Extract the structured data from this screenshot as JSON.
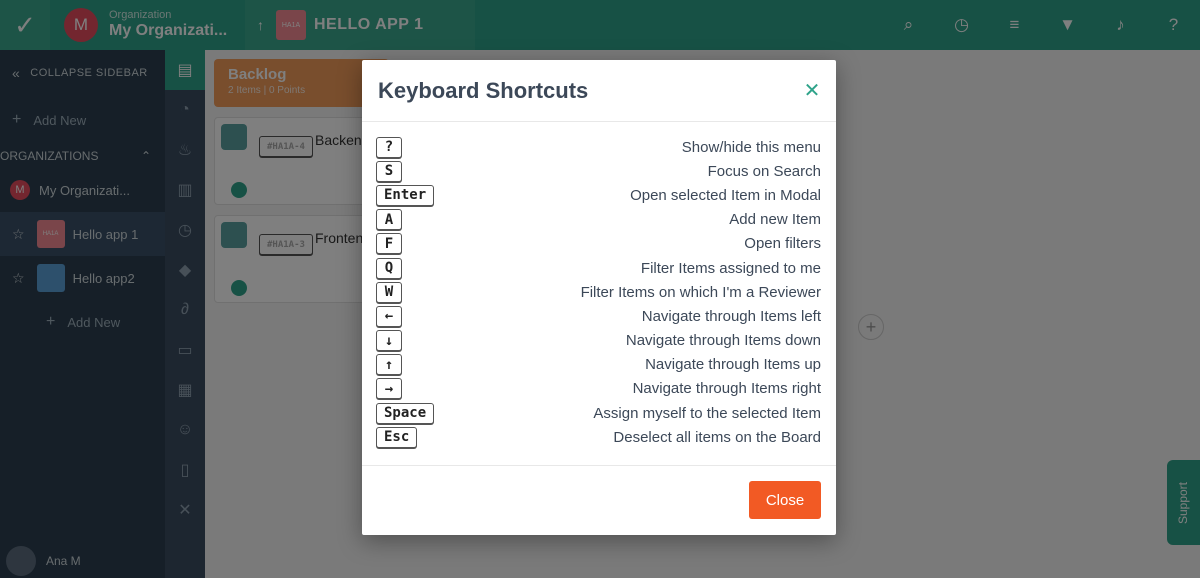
{
  "topbar": {
    "org_label": "Organization",
    "org_name": "My Organizati...",
    "org_initial": "M",
    "app_thumb": "HA1A",
    "app_title": "HELLO APP 1"
  },
  "sidebar": {
    "collapse_label": "COLLAPSE SIDEBAR",
    "add_new": "Add New",
    "section_label": "ORGANIZATIONS",
    "org_name": "My Organizati...",
    "org_initial": "M",
    "apps": [
      {
        "label": "Hello app 1",
        "thumb": "HA1A"
      },
      {
        "label": "Hello app2",
        "thumb": ""
      }
    ],
    "add_new_app": "Add New",
    "user_name": "Ana M"
  },
  "board": {
    "column_title": "Backlog",
    "column_meta": "2 Items | 0 Points",
    "cards": [
      {
        "key": "#HA1A-4",
        "title": "Backend"
      },
      {
        "key": "#HA1A-3",
        "title": "Frontend"
      }
    ],
    "support_label": "Support"
  },
  "modal": {
    "title": "Keyboard Shortcuts",
    "close_button": "Close",
    "shortcuts": [
      {
        "key": "?",
        "desc": "Show/hide this menu"
      },
      {
        "key": "S",
        "desc": "Focus on Search"
      },
      {
        "key": "Enter",
        "desc": "Open selected Item in Modal"
      },
      {
        "key": "A",
        "desc": "Add new Item"
      },
      {
        "key": "F",
        "desc": "Open filters"
      },
      {
        "key": "Q",
        "desc": "Filter Items assigned to me"
      },
      {
        "key": "W",
        "desc": "Filter Items on which I'm a Reviewer"
      },
      {
        "key": "←",
        "desc": "Navigate through Items left"
      },
      {
        "key": "↓",
        "desc": "Navigate through Items down"
      },
      {
        "key": "↑",
        "desc": "Navigate through Items up"
      },
      {
        "key": "→",
        "desc": "Navigate through Items right"
      },
      {
        "key": "Space",
        "desc": "Assign myself to the selected Item"
      },
      {
        "key": "Esc",
        "desc": "Deselect all items on the Board"
      }
    ]
  },
  "colors": {
    "brand_green": "#2fa38a",
    "sidebar_dark": "#2c3e50",
    "close_button": "#f25a24",
    "backlog_header": "#f39c5a"
  }
}
